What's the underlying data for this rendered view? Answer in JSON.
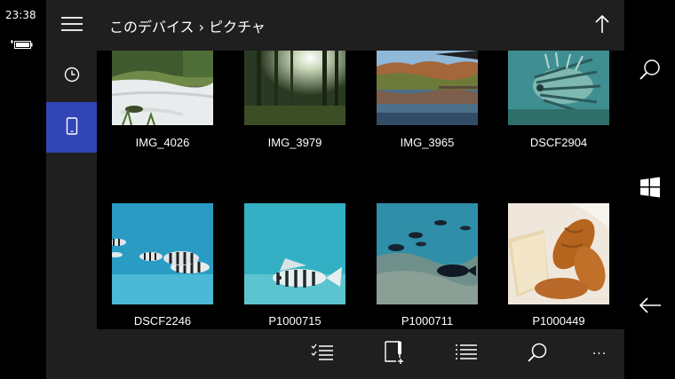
{
  "status": {
    "time": "23:38",
    "battery_icon": "battery-charging-icon"
  },
  "nav": {
    "items": [
      {
        "icon": "hamburger-menu-icon"
      },
      {
        "icon": "clock-icon"
      },
      {
        "icon": "phone-device-icon",
        "active": true
      }
    ]
  },
  "header": {
    "title": "このデバイス › ピクチャ",
    "up_icon": "arrow-up-icon"
  },
  "photos": [
    {
      "name": "IMG_4026",
      "scene": "forest-stream"
    },
    {
      "name": "IMG_3979",
      "scene": "sunlit-forest"
    },
    {
      "name": "IMG_3965",
      "scene": "autumn-lake"
    },
    {
      "name": "DSCF2904",
      "scene": "lionfish"
    },
    {
      "name": "DSCF2246",
      "scene": "striped-fish-school"
    },
    {
      "name": "P1000715",
      "scene": "striped-fish"
    },
    {
      "name": "P1000711",
      "scene": "reef-fish"
    },
    {
      "name": "P1000449",
      "scene": "bread"
    }
  ],
  "appbar": {
    "buttons": [
      {
        "icon": "select-list-icon"
      },
      {
        "icon": "new-folder-icon"
      },
      {
        "icon": "list-view-icon"
      },
      {
        "icon": "search-icon"
      },
      {
        "icon": "more-icon",
        "label": "···"
      }
    ]
  },
  "system_nav": {
    "buttons": [
      {
        "icon": "search-icon"
      },
      {
        "icon": "windows-start-icon"
      },
      {
        "icon": "back-arrow-icon"
      }
    ]
  },
  "colors": {
    "accent": "#3145b5",
    "chrome": "#1f1f1f",
    "background": "#000000"
  }
}
